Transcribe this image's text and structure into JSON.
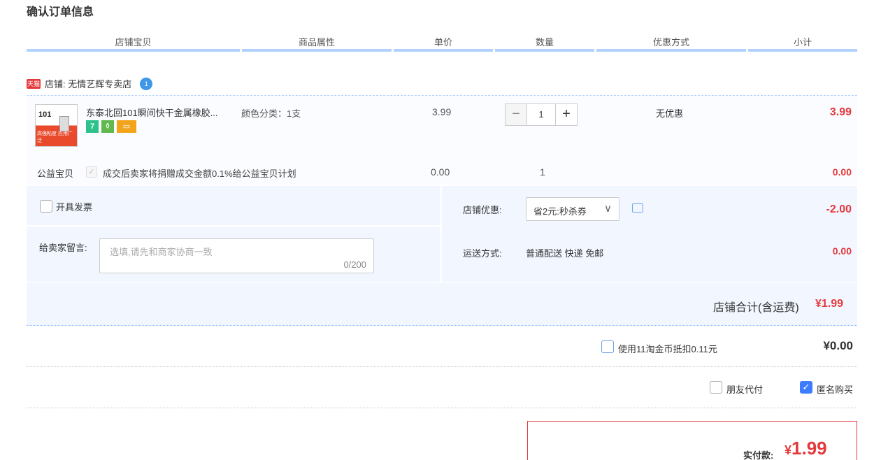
{
  "page_title": "确认订单信息",
  "columns": [
    "店铺宝贝",
    "商品属性",
    "单价",
    "数量",
    "优惠方式",
    "小计"
  ],
  "shop": {
    "badge": "天猫",
    "label": "店铺: 无情艺辉专卖店",
    "ww_icon": "1"
  },
  "item": {
    "thumb_title": "101",
    "thumb_caption": "高强粘度 应用广泛",
    "name": "东泰北回101瞬间快干金属橡胶...",
    "attr": "颜色分类：1支",
    "price": "3.99",
    "qty_minus": "−",
    "qty_value": "1",
    "qty_plus": "+",
    "promo": "无优惠",
    "subtotal": "3.99",
    "badges": [
      "7",
      "⚱",
      "▭"
    ]
  },
  "charity": {
    "label": "公益宝贝",
    "check": "✓",
    "text": "成交后卖家将捐赠成交金额0.1%给公益宝贝计划",
    "price": "0.00",
    "qty": "1",
    "subtotal": "0.00"
  },
  "invoice": {
    "label": "开具发票"
  },
  "message": {
    "label": "给卖家留言:",
    "placeholder": "选填,请先和商家协商一致",
    "counter": "0/200"
  },
  "discount": {
    "label": "店铺优惠:",
    "value": "省2元:秒杀券",
    "chevron": "∨",
    "amount": "-2.00"
  },
  "shipping": {
    "label": "运送方式:",
    "value": "普通配送 快递 免邮",
    "amount": "0.00"
  },
  "shop_total": {
    "label": "店铺合计(含运费)",
    "amount": "¥1.99"
  },
  "coin": {
    "label": "使用11淘金币抵扣0.11元",
    "amount": "¥0.00"
  },
  "friend_pay": {
    "label": "朋友代付"
  },
  "anonymous": {
    "label": "匿名购买",
    "check": "✓"
  },
  "pay": {
    "label": "实付款:",
    "currency": "¥",
    "amount": "1.99"
  },
  "colors": {
    "accent_red": "#e4393c",
    "header_line": "#b2d1ff",
    "option_bg": "#f2f7ff",
    "check_blue": "#3c7cff"
  }
}
